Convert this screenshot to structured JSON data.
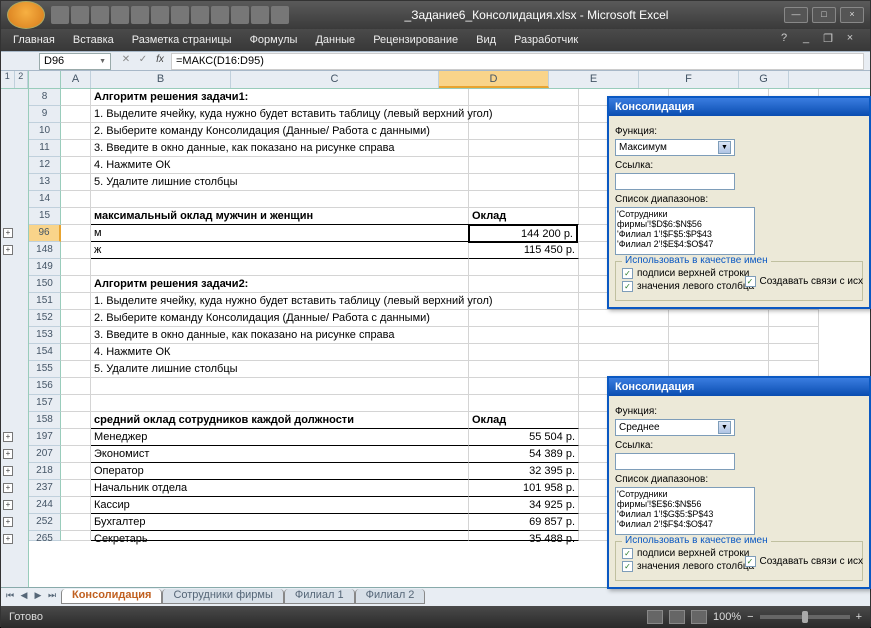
{
  "app": {
    "title": "_Задание6_Консолидация.xlsx - Microsoft Excel"
  },
  "ribbon": {
    "tabs": [
      "Главная",
      "Вставка",
      "Разметка страницы",
      "Формулы",
      "Данные",
      "Рецензирование",
      "Вид",
      "Разработчик"
    ]
  },
  "formula_bar": {
    "namebox": "D96",
    "formula": "=МАКС(D16:D95)"
  },
  "active_cell": {
    "ref": "D96",
    "row": 96,
    "col": "D"
  },
  "col_headers": [
    "A",
    "B",
    "C",
    "D",
    "E",
    "F",
    "G"
  ],
  "rows": [
    {
      "n": 8,
      "bold": true,
      "text": "Алгоритм решения задачи1:"
    },
    {
      "n": 9,
      "text": "1. Выделите ячейку, куда нужно будет вставить таблицу (левый верхний угол)"
    },
    {
      "n": 10,
      "text": "2. Выберите команду Консолидация (Данные/ Работа с данными)"
    },
    {
      "n": 11,
      "text": "3. Введите в окно данные, как показано на рисунке справа"
    },
    {
      "n": 12,
      "text": "4. Нажмите ОК"
    },
    {
      "n": 13,
      "text": "5. Удалите лишние столбцы"
    },
    {
      "n": 14,
      "text": ""
    },
    {
      "n": 15,
      "bold": true,
      "text": "максимальный оклад мужчин и женщин",
      "d": "Оклад",
      "dbold": true,
      "under": true
    },
    {
      "n": 96,
      "text": "м",
      "d": "144 200 р.",
      "active": true,
      "out": "+",
      "under": true
    },
    {
      "n": 148,
      "text": "ж",
      "d": "115 450 р.",
      "out": "+",
      "under": true
    },
    {
      "n": 149,
      "text": ""
    },
    {
      "n": 150,
      "bold": true,
      "text": "Алгоритм решения задачи2:"
    },
    {
      "n": 151,
      "text": "1. Выделите ячейку, куда нужно будет вставить таблицу (левый верхний угол)"
    },
    {
      "n": 152,
      "text": "2. Выберите команду Консолидация (Данные/ Работа с данными)"
    },
    {
      "n": 153,
      "text": "3. Введите в окно данные, как показано на рисунке справа"
    },
    {
      "n": 154,
      "text": "4. Нажмите ОК"
    },
    {
      "n": 155,
      "text": "5. Удалите лишние столбцы"
    },
    {
      "n": 156,
      "text": ""
    },
    {
      "n": 157,
      "text": ""
    },
    {
      "n": 158,
      "bold": true,
      "text": "средний оклад сотрудников каждой должности",
      "d": "Оклад",
      "dbold": true,
      "under": true
    },
    {
      "n": 197,
      "text": "Менеджер",
      "d": "55 504 р.",
      "out": "+",
      "under": true
    },
    {
      "n": 207,
      "text": "Экономист",
      "d": "54 389 р.",
      "out": "+",
      "under": true
    },
    {
      "n": 218,
      "text": "Оператор",
      "d": "32 395 р.",
      "out": "+",
      "under": true
    },
    {
      "n": 237,
      "text": "Начальник отдела",
      "d": "101 958 р.",
      "out": "+",
      "under": true
    },
    {
      "n": 244,
      "text": "Кассир",
      "d": "34 925 р.",
      "out": "+",
      "under": true
    },
    {
      "n": 252,
      "text": "Бухгалтер",
      "d": "69 857 р.",
      "out": "+",
      "under": true
    },
    {
      "n": 265,
      "text": "Секретарь",
      "d": "35 488 р.",
      "out": "+",
      "under": true,
      "clip": true
    }
  ],
  "outline_levels": [
    "1",
    "2"
  ],
  "sheets": {
    "active": "Консолидация",
    "others": [
      "Сотрудники фирмы",
      "Филиал 1",
      "Филиал 2"
    ]
  },
  "statusbar": {
    "status": "Готово",
    "zoom": "100%"
  },
  "dialog1": {
    "title": "Консолидация",
    "func_label": "Функция:",
    "func_value": "Максимум",
    "ref_label": "Ссылка:",
    "ref_value": "",
    "list_label": "Список диапазонов:",
    "list_items": [
      "'Сотрудники фирмы'!$D$6:$N$56",
      "'Филиал 1'!$F$5:$P$43",
      "'Филиал 2'!$E$4:$O$47"
    ],
    "group_title": "Использовать в качестве имен",
    "chk_top": "подписи верхней строки",
    "chk_left": "значения левого столбца",
    "chk_links": "Создавать связи с исх"
  },
  "dialog2": {
    "title": "Консолидация",
    "func_label": "Функция:",
    "func_value": "Среднее",
    "ref_label": "Ссылка:",
    "ref_value": "",
    "list_label": "Список диапазонов:",
    "list_items": [
      "'Сотрудники фирмы'!$E$6:$N$56",
      "'Филиал 1'!$G$5:$P$43",
      "'Филиал 2'!$F$4:$O$47"
    ],
    "group_title": "Использовать в качестве имен",
    "chk_top": "подписи верхней строки",
    "chk_left": "значения левого столбца",
    "chk_links": "Создавать связи с исх"
  }
}
